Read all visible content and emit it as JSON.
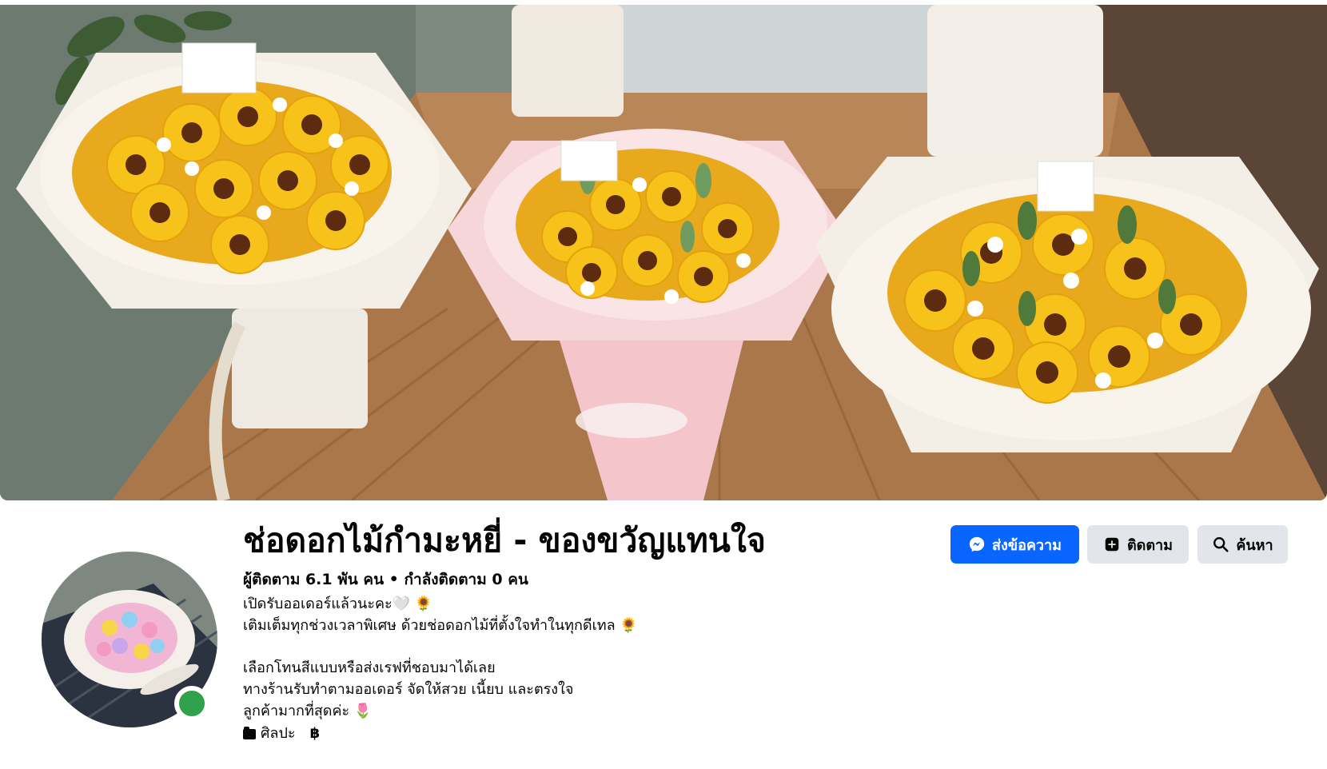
{
  "page": {
    "title": "ช่อดอกไม้กำมะหยี่ - ของขวัญแทนใจ",
    "followers": "ผู้ติดตาม 6.1 พัน คน",
    "separator": " • ",
    "following": "กำลังติดตาม 0 คน",
    "online": true
  },
  "bio": {
    "lines": [
      "เปิดรับออเดอร์แล้วนะคะ🤍 🌻",
      "เติมเต็มทุกช่วงเวลาพิเศษ ด้วยช่อดอกไม้ที่ตั้งใจทำในทุกดีเทล 🌻",
      "",
      "เลือกโทนสีแบบหรือส่งเรฟที่ชอบมาได้เลย",
      "ทางร้านรับทำตามออเดอร์ จัดให้สวย เนี้ยบ และตรงใจ",
      "ลูกค้ามากที่สุดค่ะ 🌷"
    ]
  },
  "meta": {
    "category_icon": "category-icon",
    "category": "ศิลปะ",
    "price_icon": "baht-icon",
    "price_symbol": "฿"
  },
  "actions": {
    "message_label": "ส่งข้อความ",
    "follow_label": "ติดตาม",
    "search_label": "ค้นหา"
  },
  "colors": {
    "primary": "#0866ff",
    "secondary_button": "#e2e5e9",
    "online": "#31a24c",
    "text": "#050505"
  }
}
